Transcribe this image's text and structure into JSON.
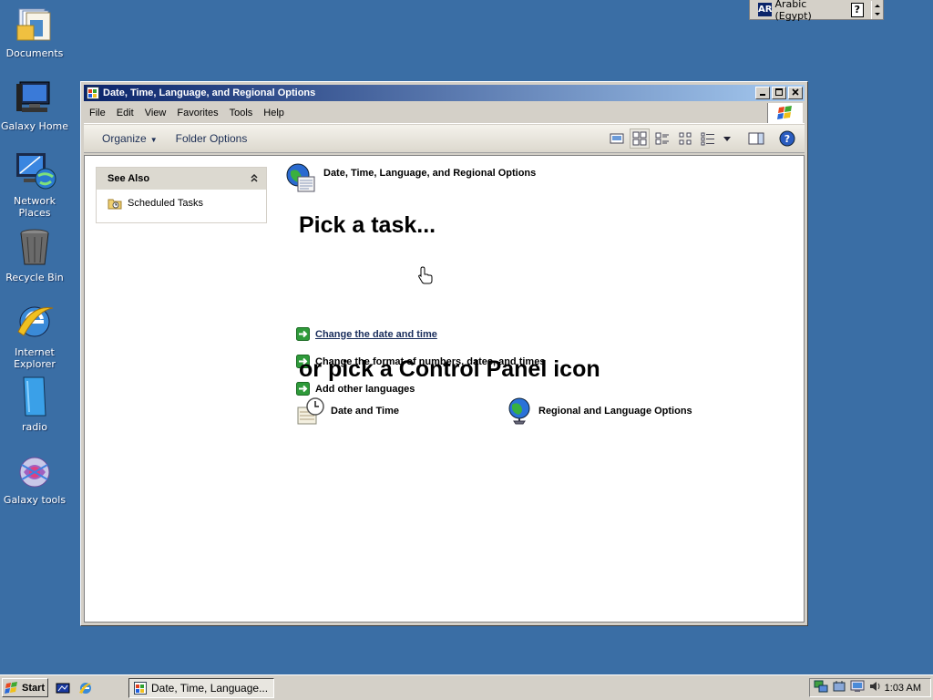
{
  "desktop": {
    "icons": [
      {
        "label": "Documents"
      },
      {
        "label": "Galaxy Home"
      },
      {
        "label": "Network Places"
      },
      {
        "label": "Recycle Bin"
      },
      {
        "label": "Internet Explorer"
      },
      {
        "label": "radio"
      },
      {
        "label": "Galaxy tools"
      }
    ]
  },
  "langbar": {
    "code": "AR",
    "language": "Arabic (Egypt)",
    "help": "?"
  },
  "window": {
    "title": "Date, Time, Language, and Regional Options",
    "menu": [
      "File",
      "Edit",
      "View",
      "Favorites",
      "Tools",
      "Help"
    ],
    "commands": {
      "organize": "Organize",
      "folder_options": "Folder Options"
    },
    "see_also": {
      "heading": "See Also",
      "items": [
        {
          "label": "Scheduled Tasks"
        }
      ]
    },
    "category_title": "Date, Time, Language, and Regional Options",
    "pick_task_heading": "Pick a task...",
    "tasks": [
      {
        "label": "Change the date and time"
      },
      {
        "label": "Change the format of numbers, dates, and times"
      },
      {
        "label": "Add other languages"
      }
    ],
    "pick_icon_heading": "or pick a Control Panel icon",
    "icons": [
      {
        "label": "Date and Time"
      },
      {
        "label": "Regional and Language Options"
      }
    ]
  },
  "taskbar": {
    "start_label": "Start",
    "active_task": "Date, Time, Language...",
    "clock": "1:03 AM"
  },
  "colors": {
    "desktop": "#3a6ea5",
    "titlebar": "#0a246a",
    "link": "#1a2e5c",
    "arrow_green": "#2e9a3a"
  }
}
